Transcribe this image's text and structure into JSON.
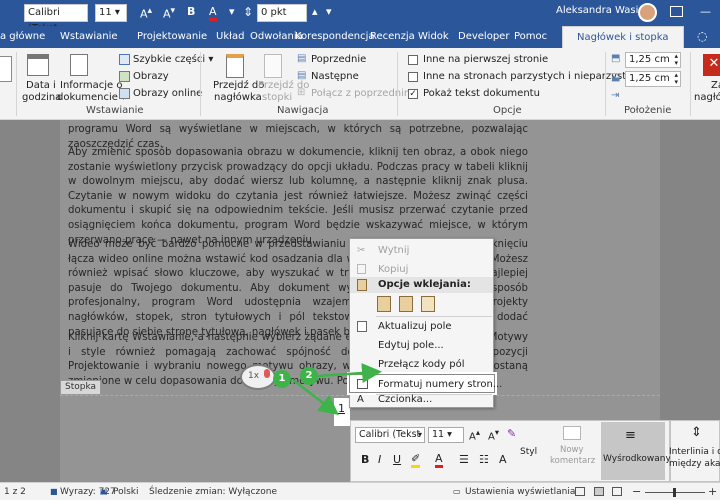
{
  "qat": {
    "font_name": "Calibri (Tekst",
    "font_size": "11",
    "spacing": "0 pkt",
    "user": "Aleksandra Wasiak"
  },
  "tabs": [
    "a główne",
    "Wstawianie",
    "Projektowanie",
    "Układ",
    "Odwołania",
    "Korespondencja",
    "Recenzja",
    "Widok",
    "Developer",
    "Pomoc",
    "Nagłówek i stopka"
  ],
  "ribbon": {
    "date_time": [
      "Data i",
      "godzina"
    ],
    "doc_info": [
      "Informacje o",
      "dokumencie"
    ],
    "quick_parts": "Szybkie części",
    "pictures": "Obrazy",
    "online_pictures": "Obrazy online",
    "group_insert": "Wstawianie",
    "goto_header": [
      "Przejdź do",
      "nagłówka"
    ],
    "goto_footer": [
      "Przejdź do",
      "stopki"
    ],
    "previous": "Poprzednie",
    "next": "Następne",
    "link_prev": "Połącz z poprzednim",
    "group_nav": "Nawigacja",
    "diff_first": "Inne na pierwszej stronie",
    "diff_odd_even": "Inne na stronach parzystych i nieparzystych",
    "show_doc_text": "Pokaż tekst dokumentu",
    "group_options": "Opcje",
    "header_pos": "1,25 cm",
    "footer_pos": "1,25 cm",
    "group_position": "Położenie",
    "close_label": [
      "Za",
      "nagłówe"
    ]
  },
  "document": {
    "p0": "programu Word są wyświetlane w miejscach, w których są potrzebne, pozwalając zaoszczędzić czas.",
    "p1": "Aby zmienić sposób dopasowania obrazu w dokumencie, kliknij ten obraz, a obok niego zostanie wyświetlony przycisk prowadzący do opcji układu. Podczas pracy w tabeli kliknij w dowolnym miejscu, aby dodać wiersz lub kolumnę, a następnie kliknij znak plusa. Czytanie w nowym widoku do czytania jest również łatwiejsze. Możesz zwinąć części dokumentu i skupić się na odpowiednim tekście. Jeśli musisz przerwać czytanie przed osiągnięciem końca dokumentu, program Word będzie wskazywać miejsce, w którym przerwano pracę — nawet na innym urządzeniu.",
    "p2": "Wideo może być bardzo pomocne w przedstawianiu Twojego stanowiska. Po kliknięciu łącza wideo online można wstawić kod osadzania dla wideo, które chcesz dodać. Możesz również wpisać słowo kluczowe, aby wyszukać w trybie online wideo, które najlepiej pasuje do Twojego dokumentu. Aby dokument wyglądał na utworzony w sposób profesjonalny, program Word udostępnia wzajemnie się uzupełniające projekty nagłówków, stopek, stron tytułowych i pól tekstowych. Na przykład można dodać pasujące do siebie stronę tytułową, nagłówek i pasek boczny.",
    "p3": "Kliknij kartę Wstawianie, a następnie wybierz żądane elementy z różnych galerii. Motywy i style również pomagają zachować spójność dokumentu. Po kliknięciu pozycji Projektowanie i wybraniu nowego motywu obrazy, wykresy i grafiki SmartArt zostaną zmienione w celu dopasowania do nowego motywu. Po",
    "footer_tag": "Stopka",
    "page_number": "1"
  },
  "context_menu": {
    "cut": "Wytnij",
    "copy": "Kopiuj",
    "paste_header": "Opcje wklejania:",
    "update_field": "Aktualizuj pole",
    "edit_field": "Edytuj pole...",
    "toggle_codes": "Przełącz kody pól",
    "format_numbers": "Formatuj numery stron...",
    "font": "Czcionka..."
  },
  "mini_toolbar": {
    "font": "Calibri (Tekst p",
    "size": "11",
    "style": "Styl",
    "new_comment": [
      "Nowy",
      "komentarz"
    ],
    "center": "Wyśrodkowany",
    "spacing": [
      "Interlinia i od",
      "między akapi"
    ]
  },
  "annotations": {
    "step1": "1",
    "step2": "2",
    "click_badge": "1x"
  },
  "statusbar": {
    "page": "1 z 2",
    "words": "Wyrazy: 727",
    "lang": "Polski",
    "tracking": "Śledzenie zmian: Wyłączone",
    "view_settings": "Ustawienia wyświetlania"
  },
  "colors": {
    "word_blue": "#2b579a",
    "accent_green": "#3eb34a"
  }
}
